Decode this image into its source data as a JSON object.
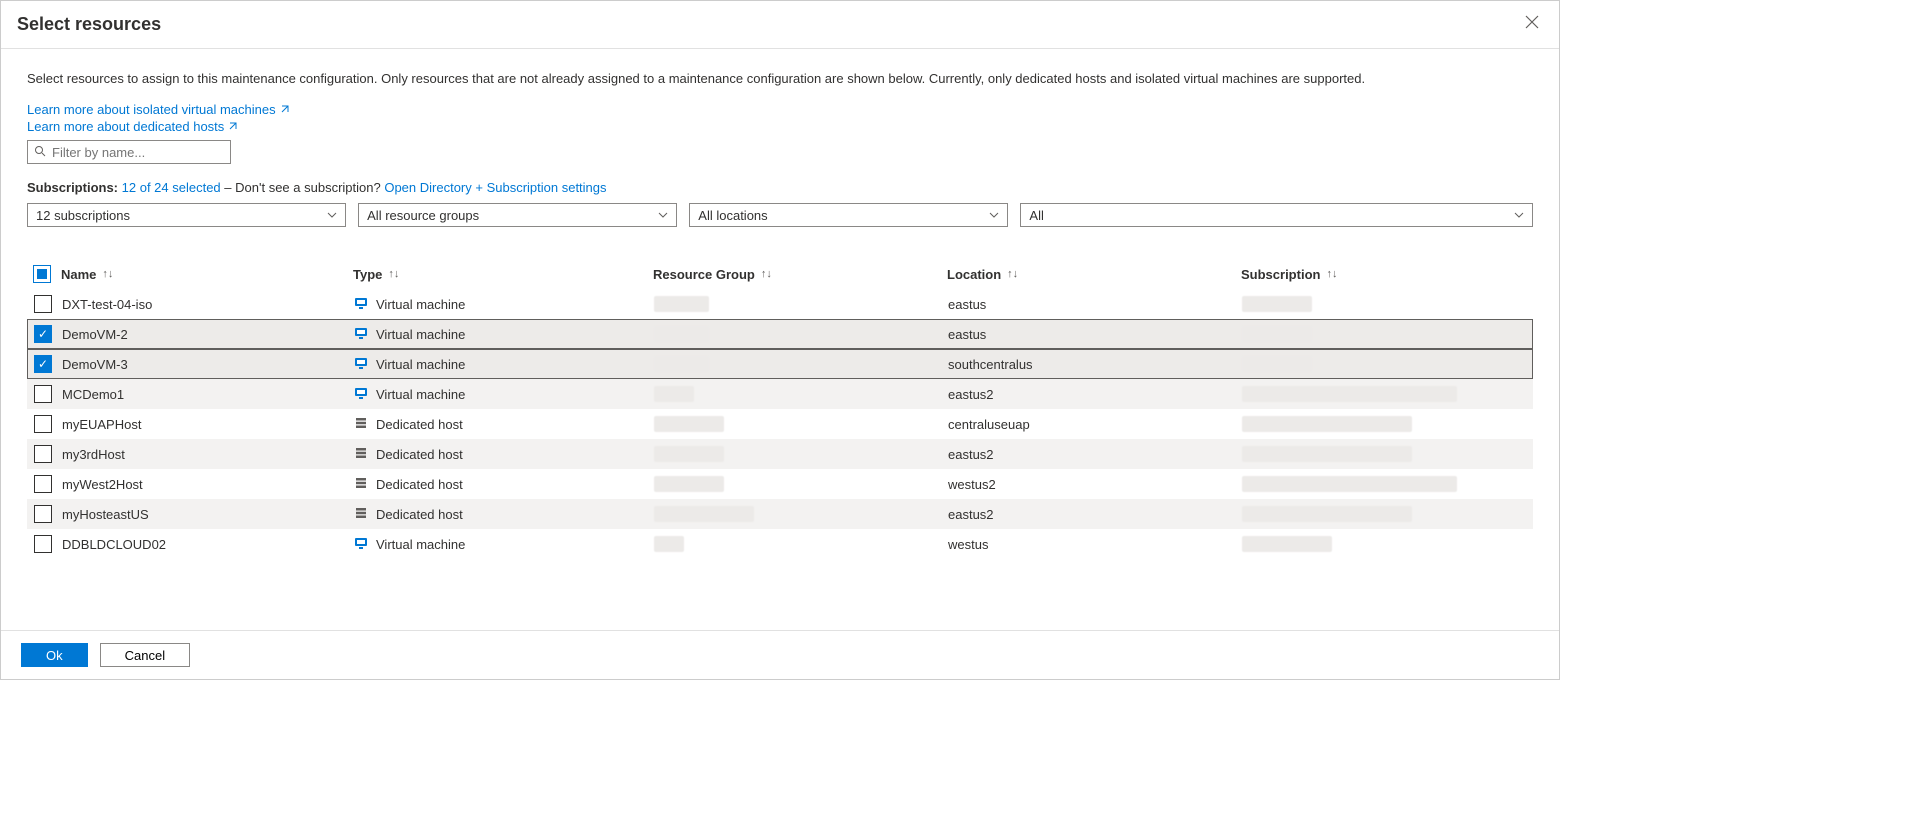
{
  "header": {
    "title": "Select resources"
  },
  "intro": "Select resources to assign to this maintenance configuration. Only resources that are not already assigned to a maintenance configuration are shown below. Currently, only dedicated hosts and isolated virtual machines are supported.",
  "links": {
    "vm": "Learn more about isolated virtual machines",
    "host": "Learn more about dedicated hosts"
  },
  "search": {
    "placeholder": "Filter by name..."
  },
  "subscriptions": {
    "label": "Subscriptions:",
    "count": "12 of 24 selected",
    "hint": " – Don't see a subscription? ",
    "settings": "Open Directory + Subscription settings"
  },
  "filters": {
    "subs": "12 subscriptions",
    "rg": "All resource groups",
    "loc": "All locations",
    "type": "All"
  },
  "columns": {
    "name": "Name",
    "type": "Type",
    "rg": "Resource Group",
    "loc": "Location",
    "sub": "Subscription"
  },
  "typeLabels": {
    "vm": "Virtual machine",
    "host": "Dedicated host"
  },
  "rows": [
    {
      "name": "DXT-test-04-iso",
      "type": "vm",
      "loc": "eastus",
      "checked": false,
      "rgw": 55,
      "subw": 70
    },
    {
      "name": "DemoVM-2",
      "type": "vm",
      "loc": "eastus",
      "checked": true,
      "rgw": 55,
      "subw": 70
    },
    {
      "name": "DemoVM-3",
      "type": "vm",
      "loc": "southcentralus",
      "checked": true,
      "rgw": 55,
      "subw": 70
    },
    {
      "name": "MCDemo1",
      "type": "vm",
      "loc": "eastus2",
      "checked": false,
      "rgw": 40,
      "subw": 215
    },
    {
      "name": "myEUAPHost",
      "type": "host",
      "loc": "centraluseuap",
      "checked": false,
      "rgw": 70,
      "subw": 170
    },
    {
      "name": "my3rdHost",
      "type": "host",
      "loc": "eastus2",
      "checked": false,
      "rgw": 70,
      "subw": 170
    },
    {
      "name": "myWest2Host",
      "type": "host",
      "loc": "westus2",
      "checked": false,
      "rgw": 70,
      "subw": 215
    },
    {
      "name": "myHosteastUS",
      "type": "host",
      "loc": "eastus2",
      "checked": false,
      "rgw": 100,
      "subw": 170
    },
    {
      "name": "DDBLDCLOUD02",
      "type": "vm",
      "loc": "westus",
      "checked": false,
      "rgw": 30,
      "subw": 90
    }
  ],
  "buttons": {
    "ok": "Ok",
    "cancel": "Cancel"
  }
}
